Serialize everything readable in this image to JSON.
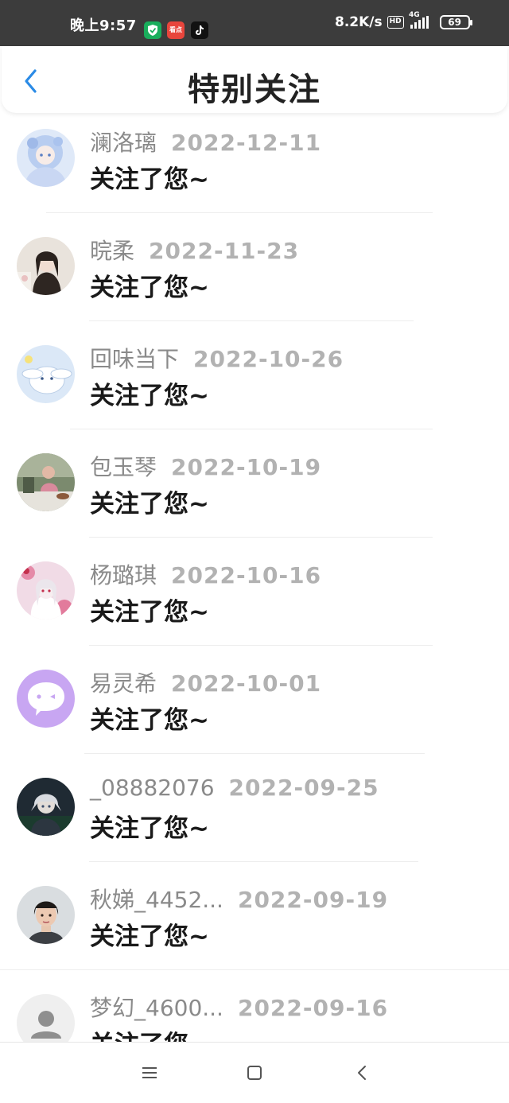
{
  "status_bar": {
    "time": "晚上9:57",
    "net_speed": "8.2K/s",
    "hd_label": "HD",
    "network_type": "4G",
    "battery": "69",
    "app_icons": [
      "shield-app-icon",
      "news-app-icon",
      "tiktok-app-icon"
    ],
    "news_icon_text": "看点"
  },
  "header": {
    "title": "特别关注",
    "back_icon": "chevron-left-icon",
    "accent_color": "#2b8be6"
  },
  "list": {
    "items": [
      {
        "name": "澜洛璃",
        "date": "2022-12-11",
        "action": "关注了您~",
        "avatar": "anime-girl-blue"
      },
      {
        "name": "晥柔",
        "date": "2022-11-23",
        "action": "关注了您~",
        "avatar": "girl-photo"
      },
      {
        "name": "回味当下",
        "date": "2022-10-26",
        "action": "关注了您~",
        "avatar": "cinnamoroll"
      },
      {
        "name": "包玉琴",
        "date": "2022-10-19",
        "action": "关注了您~",
        "avatar": "child-photo"
      },
      {
        "name": "杨璐琪",
        "date": "2022-10-16",
        "action": "关注了您~",
        "avatar": "anime-girl-white"
      },
      {
        "name": "易灵希",
        "date": "2022-10-01",
        "action": "关注了您~",
        "avatar": "chat-bubble-purple"
      },
      {
        "name": "_08882076",
        "date": "2022-09-25",
        "action": "关注了您~",
        "avatar": "anime-boy-dark"
      },
      {
        "name": "秋娣_4452...",
        "date": "2022-09-19",
        "action": "关注了您~",
        "avatar": "woman-photo"
      },
      {
        "name": "梦幻_4600...",
        "date": "2022-09-16",
        "action": "关注了您~",
        "avatar": "default-person"
      }
    ]
  },
  "nav_bar": {
    "icons": [
      "menu-icon",
      "home-square-icon",
      "back-triangle-icon"
    ]
  }
}
